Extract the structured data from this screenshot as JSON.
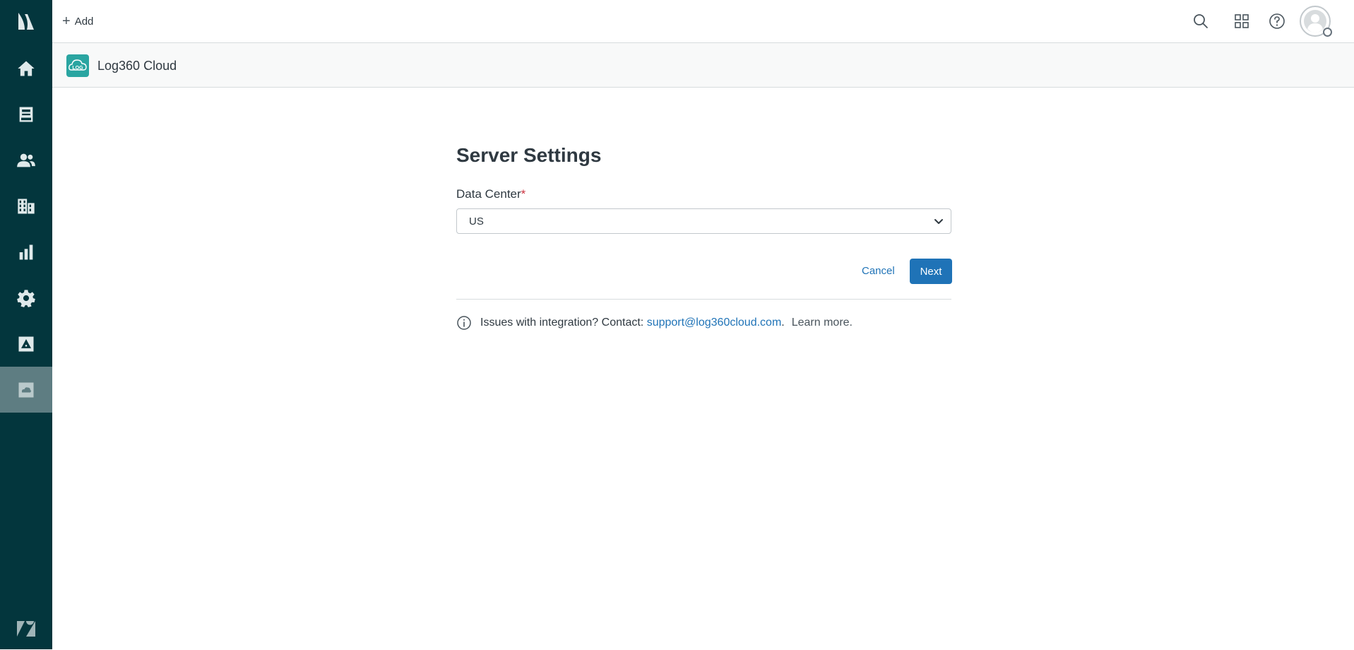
{
  "sidebar": {
    "items": [
      {
        "name": "home",
        "icon": "home-icon"
      },
      {
        "name": "tickets",
        "icon": "inbox-icon"
      },
      {
        "name": "customers",
        "icon": "users-icon"
      },
      {
        "name": "organizations",
        "icon": "building-icon"
      },
      {
        "name": "reporting",
        "icon": "bar-chart-icon"
      },
      {
        "name": "admin",
        "icon": "gear-icon"
      },
      {
        "name": "guide",
        "icon": "image-icon"
      },
      {
        "name": "log360",
        "icon": "app-icon",
        "active": true
      }
    ]
  },
  "topbar": {
    "add_label": "Add"
  },
  "app": {
    "title": "Log360 Cloud",
    "logo_text": "LOG"
  },
  "form": {
    "title": "Server Settings",
    "data_center_label": "Data Center",
    "required_marker": "*",
    "data_center_value": "US",
    "cancel_label": "Cancel",
    "next_label": "Next"
  },
  "info": {
    "text": "Issues with integration? Contact:",
    "email": "support@log360cloud.com",
    "after_email": ".",
    "learn_more": "Learn more."
  },
  "colors": {
    "sidebar_bg": "#03363d",
    "accent": "#1f73b7",
    "app_logo": "#2aa5a1"
  }
}
